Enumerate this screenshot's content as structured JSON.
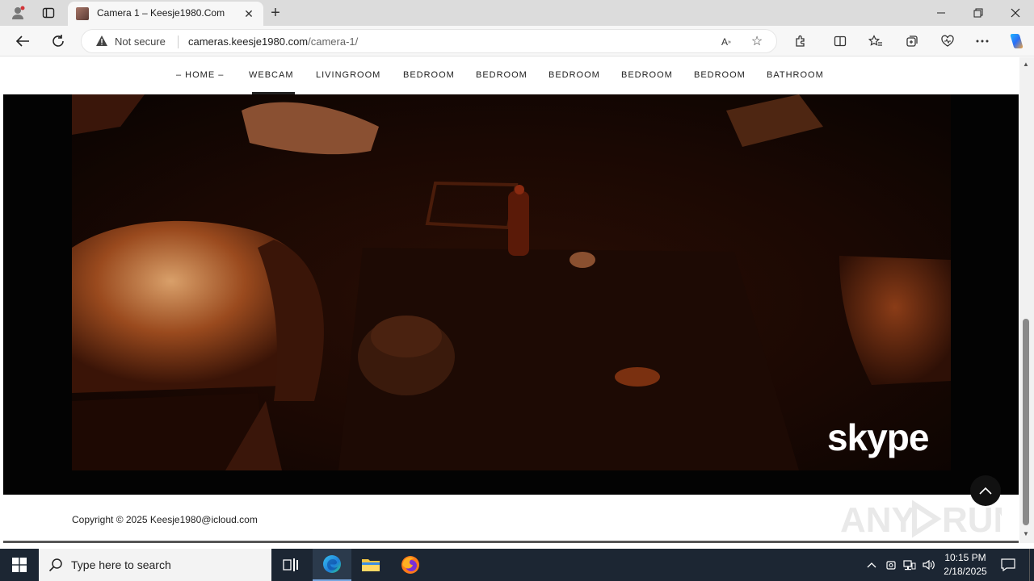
{
  "browser": {
    "tab": {
      "title": "Camera 1 – Keesje1980.Com"
    },
    "address": {
      "security_label": "Not secure",
      "url_host": "cameras.keesje1980.com",
      "url_path": "/camera-1/"
    }
  },
  "site": {
    "menu": [
      {
        "label": "– HOME –"
      },
      {
        "label": "WEBCAM"
      },
      {
        "label": "LIVINGROOM"
      },
      {
        "label": "BEDROOM"
      },
      {
        "label": "BEDROOM"
      },
      {
        "label": "BEDROOM"
      },
      {
        "label": "BEDROOM"
      },
      {
        "label": "BEDROOM"
      },
      {
        "label": "BATHROOM"
      }
    ],
    "active_menu": "WEBCAM",
    "video": {
      "watermark": "skype"
    },
    "footer": {
      "copyright": "Copyright © 2025 Keesje1980@icloud.com"
    },
    "overlay_watermark": "ANY RUN"
  },
  "taskbar": {
    "search_placeholder": "Type here to search",
    "clock": {
      "time": "10:15 PM",
      "date": "2/18/2025"
    }
  },
  "colors": {
    "tabstrip": "#dcdcdc",
    "taskbar": "#1c2633",
    "video_bg": "#030303",
    "accent": "#0078d4"
  }
}
